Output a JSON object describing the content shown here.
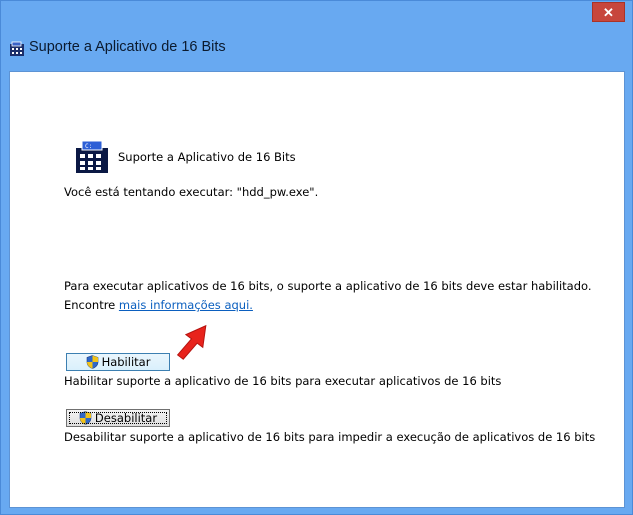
{
  "window": {
    "title": "Suporte a Aplicativo de 16 Bits",
    "close_label": "✕"
  },
  "content": {
    "app_title": "Suporte a Aplicativo de 16 Bits",
    "running_text": "Você está tentando executar: \"hdd_pw.exe\".",
    "info_text": "Para executar aplicativos de 16 bits, o suporte a aplicativo de 16 bits deve estar habilitado.",
    "more_prefix": "Encontre ",
    "more_link": "mais informações aqui.",
    "enable": {
      "label": "Habilitar",
      "description": "Habilitar suporte a aplicativo de 16 bits para executar aplicativos de 16 bits"
    },
    "disable": {
      "label": "Desabilitar",
      "description": "Desabilitar suporte a aplicativo de 16 bits para impedir a execução de aplicativos de 16 bits"
    }
  },
  "colors": {
    "title_bar": "#68a9f1",
    "close_button": "#c7463c",
    "link": "#0b5fbf",
    "annotation_arrow": "#e8231c"
  }
}
